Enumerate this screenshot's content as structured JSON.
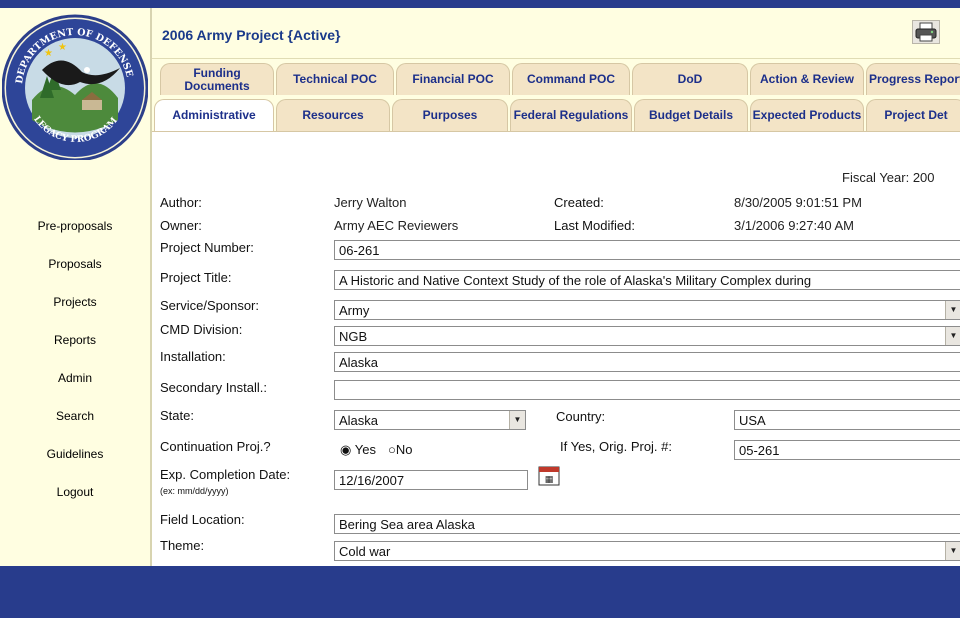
{
  "title": "2006 Army Project {Active}",
  "logo": {
    "text_top": "DEPARTMENT OF DEFENSE",
    "text_bottom": "LEGACY PROGRAM"
  },
  "nav": [
    "Pre-proposals",
    "Proposals",
    "Projects",
    "Reports",
    "Admin",
    "Search",
    "Guidelines",
    "Logout"
  ],
  "tabs_row1": [
    "Funding Documents",
    "Technical POC",
    "Financial POC",
    "Command POC",
    "DoD",
    "Action & Review",
    "Progress Report"
  ],
  "tabs_row2": [
    "Administrative",
    "Resources",
    "Purposes",
    "Federal Regulations",
    "Budget Details",
    "Expected Products",
    "Project Det"
  ],
  "active_tab": "Administrative",
  "form": {
    "fiscal_year": "Fiscal Year: 200",
    "author_label": "Author:",
    "author": "Jerry Walton",
    "created_label": "Created:",
    "created": "8/30/2005 9:01:51 PM",
    "owner_label": "Owner:",
    "owner": "Army AEC Reviewers",
    "modified_label": "Last Modified:",
    "modified": "3/1/2006 9:27:40 AM",
    "project_number_label": "Project Number:",
    "project_number": "06-261",
    "project_title_label": "Project Title:",
    "project_title": "A Historic and Native Context Study of the role of Alaska's Military Complex during",
    "service_label": "Service/Sponsor:",
    "service": "Army",
    "cmd_label": "CMD Division:",
    "cmd": "NGB",
    "installation_label": "Installation:",
    "installation": "Alaska",
    "secondary_label": "Secondary Install.:",
    "secondary": "",
    "state_label": "State:",
    "state": "Alaska",
    "country_label": "Country:",
    "country": "USA",
    "continuation_label": "Continuation Proj.?",
    "yes_label": "Yes",
    "no_label": "No",
    "orig_label": "If Yes, Orig. Proj. #:",
    "orig": "05-261",
    "completion_label": "Exp. Completion Date:",
    "completion_hint": "(ex: mm/dd/yyyy)",
    "completion": "12/16/2007",
    "field_location_label": "Field Location:",
    "field_location": "Bering Sea area Alaska",
    "theme_label": "Theme:",
    "theme": "Cold war"
  },
  "colors": {
    "bar": "#283c8c",
    "sidebar": "#fffee1",
    "tab": "#f3e4c6",
    "title": "#1a3a8a"
  },
  "icons": [
    "printer-icon",
    "calendar-icon",
    "eagle-seal-icon"
  ]
}
